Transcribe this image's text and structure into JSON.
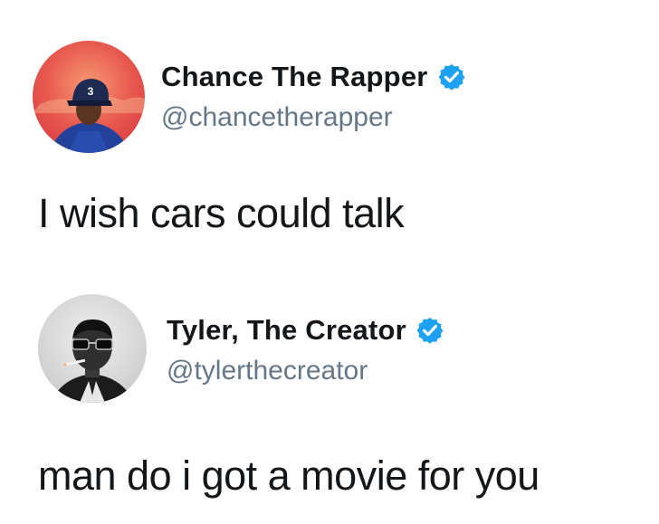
{
  "tweets": [
    {
      "display_name": "Chance The Rapper",
      "handle": "@chancetherapper",
      "verified": true,
      "avatar_cap_text": "3",
      "text": "I wish cars could talk",
      "colors": {
        "avatar_bg": "#e8594f",
        "cap": "#1f2a52"
      }
    },
    {
      "display_name": "Tyler, The Creator",
      "handle": "@tylerthecreator",
      "verified": true,
      "text": "man do i got a movie for you",
      "colors": {
        "avatar_bg": "#d9d9d9"
      }
    }
  ],
  "colors": {
    "verified_badge": "#1da1f2",
    "handle": "#657786",
    "text": "#14171a"
  },
  "icons": [
    "verified-badge-icon"
  ]
}
